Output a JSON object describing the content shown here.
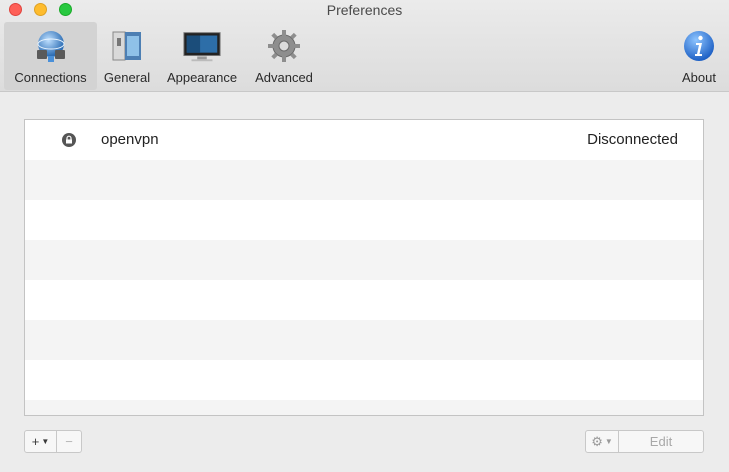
{
  "window": {
    "title": "Preferences"
  },
  "toolbar": {
    "items": [
      {
        "label": "Connections",
        "icon": "connections-icon",
        "selected": true
      },
      {
        "label": "General",
        "icon": "general-icon",
        "selected": false
      },
      {
        "label": "Appearance",
        "icon": "appearance-icon",
        "selected": false
      },
      {
        "label": "Advanced",
        "icon": "gear-icon",
        "selected": false
      }
    ],
    "about": {
      "label": "About",
      "icon": "info-icon"
    }
  },
  "connections": [
    {
      "name": "openvpn",
      "status": "Disconnected",
      "icon": "lock-icon"
    }
  ],
  "bottom_bar": {
    "add_label": "+",
    "remove_label": "−",
    "edit_label": "Edit"
  }
}
